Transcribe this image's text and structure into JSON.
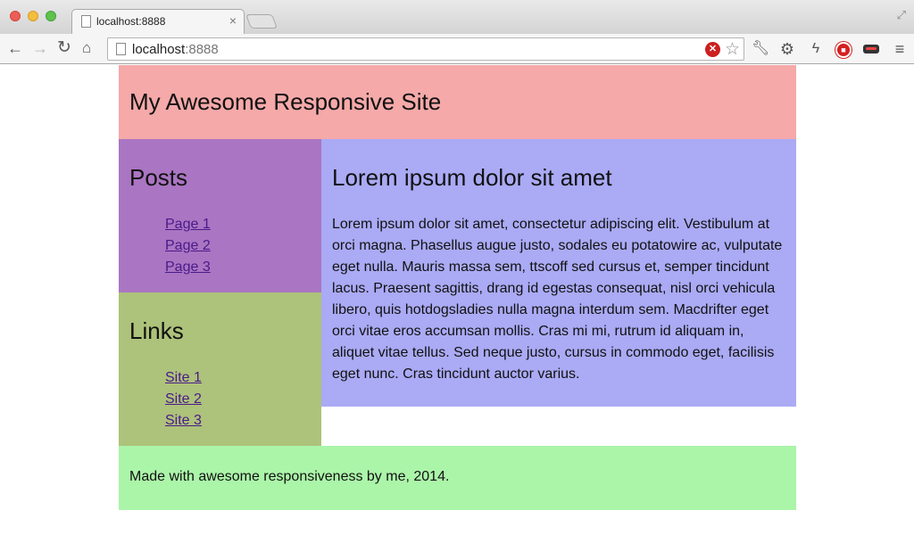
{
  "browser": {
    "tab_title": "localhost:8888",
    "tab_close": "×",
    "url_host": "localhost",
    "url_port": ":8888",
    "icons": [
      "back-icon",
      "forward-icon",
      "reload-icon",
      "home-icon",
      "page-icon",
      "stop-icon",
      "star-icon",
      "wrench-icon",
      "gear-icon",
      "bolt-icon",
      "adblock-icon",
      "mask-icon",
      "menu-icon"
    ]
  },
  "site": {
    "title": "My Awesome Responsive Site",
    "posts": {
      "heading": "Posts",
      "items": [
        "Page 1",
        "Page 2",
        "Page 3"
      ]
    },
    "links": {
      "heading": "Links",
      "items": [
        "Site 1",
        "Site 2",
        "Site 3"
      ]
    },
    "main": {
      "heading": "Lorem ipsum dolor sit amet",
      "body": "Lorem ipsum dolor sit amet, consectetur adipiscing elit. Vestibulum at orci magna. Phasellus augue justo, sodales eu potatowire ac, vulputate eget nulla. Mauris massa sem, ttscoff sed cursus et, semper tincidunt lacus. Praesent sagittis, drang id egestas consequat, nisl orci vehicula libero, quis hotdogsladies nulla magna interdum sem. Macdrifter eget orci vitae eros accumsan mollis. Cras mi mi, rutrum id aliquam in, aliquet vitae tellus. Sed neque justo, cursus in commodo eget, facilisis eget nunc. Cras tincidunt auctor varius."
    },
    "footer": "Made with awesome responsiveness by me, 2014."
  },
  "colors": {
    "header": "#f5a9a9",
    "posts": "#aa75c2",
    "links": "#adc27a",
    "main": "#aaaaf5",
    "footer": "#abf5a9"
  }
}
